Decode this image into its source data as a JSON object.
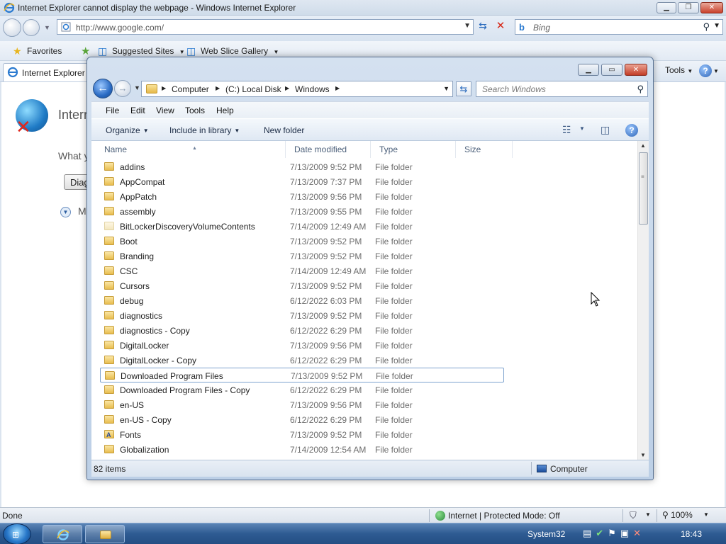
{
  "ie": {
    "title": "Internet Explorer cannot display the webpage - Windows Internet Explorer",
    "url": "http://www.google.com/",
    "search_placeholder": "Bing",
    "favorites_label": "Favorites",
    "suggested_sites_label": "Suggested Sites",
    "web_slice_label": "Web Slice Gallery",
    "tab_title": "Internet Explorer",
    "tools_label": "Tools",
    "page_title_fragment": "Intern",
    "what_fragment": "What y",
    "diag_fragment": "Diag",
    "more_fragment": "M",
    "status_done": "Done",
    "zone_label": "Internet | Protected Mode: Off",
    "zoom": "100%"
  },
  "explorer": {
    "breadcrumbs": [
      "Computer",
      "(C:) Local Disk",
      "Windows"
    ],
    "search_placeholder": "Search Windows",
    "menu": [
      "File",
      "Edit",
      "View",
      "Tools",
      "Help"
    ],
    "commands": {
      "organize": "Organize",
      "include_in_library": "Include in library",
      "new_folder": "New folder"
    },
    "columns": [
      "Name",
      "Date modified",
      "Type",
      "Size"
    ],
    "rows": [
      {
        "name": "addins",
        "date": "7/13/2009 9:52 PM",
        "type": "File folder"
      },
      {
        "name": "AppCompat",
        "date": "7/13/2009 7:37 PM",
        "type": "File folder"
      },
      {
        "name": "AppPatch",
        "date": "7/13/2009 9:56 PM",
        "type": "File folder"
      },
      {
        "name": "assembly",
        "date": "7/13/2009 9:55 PM",
        "type": "File folder"
      },
      {
        "name": "BitLockerDiscoveryVolumeContents",
        "date": "7/14/2009 12:49 AM",
        "type": "File folder"
      },
      {
        "name": "Boot",
        "date": "7/13/2009 9:52 PM",
        "type": "File folder"
      },
      {
        "name": "Branding",
        "date": "7/13/2009 9:52 PM",
        "type": "File folder"
      },
      {
        "name": "CSC",
        "date": "7/14/2009 12:49 AM",
        "type": "File folder"
      },
      {
        "name": "Cursors",
        "date": "7/13/2009 9:52 PM",
        "type": "File folder"
      },
      {
        "name": "debug",
        "date": "6/12/2022 6:03 PM",
        "type": "File folder"
      },
      {
        "name": "diagnostics",
        "date": "7/13/2009 9:52 PM",
        "type": "File folder"
      },
      {
        "name": "diagnostics - Copy",
        "date": "6/12/2022 6:29 PM",
        "type": "File folder"
      },
      {
        "name": "DigitalLocker",
        "date": "7/13/2009 9:56 PM",
        "type": "File folder"
      },
      {
        "name": "DigitalLocker - Copy",
        "date": "6/12/2022 6:29 PM",
        "type": "File folder"
      },
      {
        "name": "Downloaded Program Files",
        "date": "7/13/2009 9:52 PM",
        "type": "File folder"
      },
      {
        "name": "Downloaded Program Files - Copy",
        "date": "6/12/2022 6:29 PM",
        "type": "File folder"
      },
      {
        "name": "en-US",
        "date": "7/13/2009 9:56 PM",
        "type": "File folder"
      },
      {
        "name": "en-US - Copy",
        "date": "6/12/2022 6:29 PM",
        "type": "File folder"
      },
      {
        "name": "Fonts",
        "date": "7/13/2009 9:52 PM",
        "type": "File folder"
      },
      {
        "name": "Globalization",
        "date": "7/14/2009 12:54 AM",
        "type": "File folder"
      }
    ],
    "item_count": "82 items",
    "status_location": "Computer"
  },
  "taskbar": {
    "toolbar_label": "System32",
    "clock": "18:43"
  }
}
